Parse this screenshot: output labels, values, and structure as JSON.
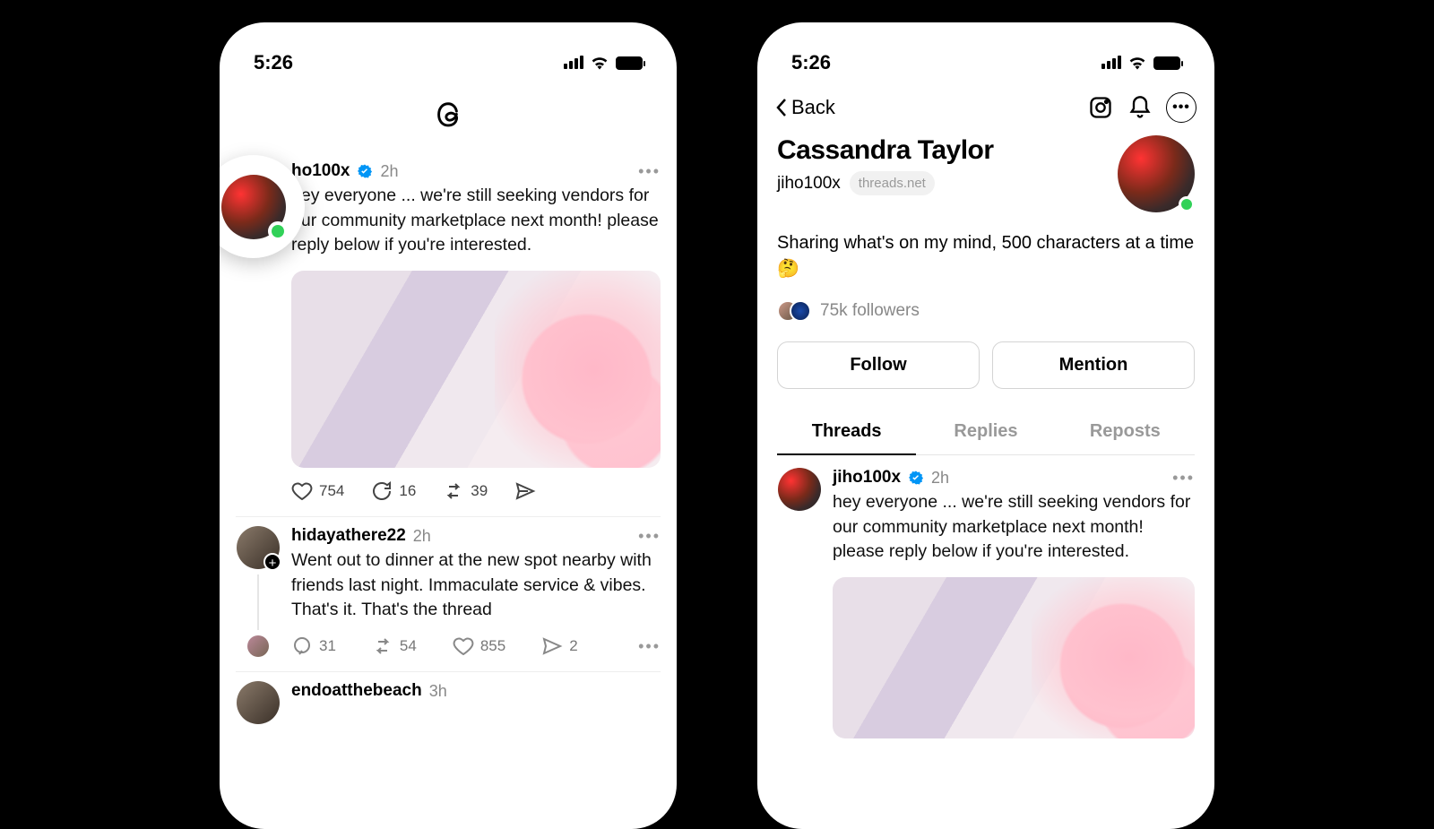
{
  "status": {
    "time": "5:26"
  },
  "left": {
    "post1": {
      "username": "jiho100x",
      "username_partial": "ho100x",
      "time": "2h",
      "body": "hey everyone ... we're still seeking vendors for our community marketplace next month! please reply below if you're interested.",
      "likes": "754",
      "comments": "16",
      "reposts": "39"
    },
    "post2": {
      "username": "hidayathere22",
      "time": "2h",
      "body": "Went out to dinner at the new spot nearby with friends last night. Immaculate service & vibes. That's it. That's the thread",
      "comments": "31",
      "reposts": "54",
      "likes": "855",
      "shares": "2"
    },
    "post3": {
      "username": "endoatthebeach",
      "time": "3h"
    }
  },
  "right": {
    "back": "Back",
    "display_name": "Cassandra Taylor",
    "handle": "jiho100x",
    "domain": "threads.net",
    "bio": "Sharing what's on my mind, 500 characters at a time 🤔",
    "followers": "75k followers",
    "follow_btn": "Follow",
    "mention_btn": "Mention",
    "tabs": {
      "threads": "Threads",
      "replies": "Replies",
      "reposts": "Reposts"
    },
    "post": {
      "username": "jiho100x",
      "time": "2h",
      "body": "hey everyone ... we're still seeking vendors for our community marketplace next month! please reply below if you're interested."
    }
  }
}
